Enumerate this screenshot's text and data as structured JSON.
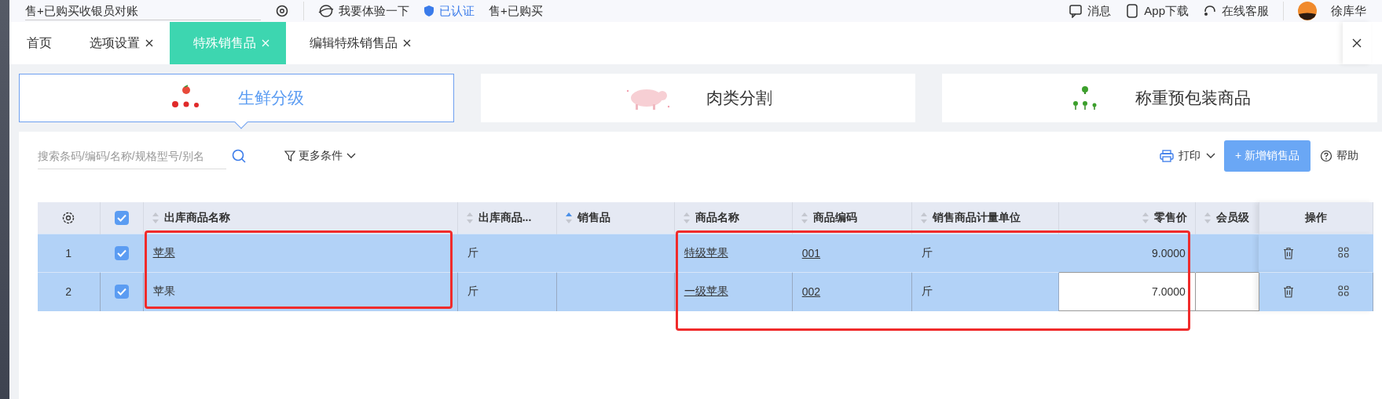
{
  "top_bar": {
    "shop_field": "售+已购买收银员对账",
    "links": [
      {
        "kind": "demo",
        "label": "我要体验一下"
      },
      {
        "kind": "verified",
        "label": "已认证"
      },
      {
        "kind": "plain",
        "label": "售+已购买"
      }
    ],
    "actions": [
      {
        "kind": "message",
        "label": "消息"
      },
      {
        "kind": "app",
        "label": "App下载"
      },
      {
        "kind": "service",
        "label": "在线客服"
      }
    ],
    "user": "徐库华"
  },
  "tabs": [
    {
      "label": "首页",
      "closable": false,
      "selected": false
    },
    {
      "label": "选项设置",
      "closable": true,
      "selected": false
    },
    {
      "label": "特殊销售品",
      "closable": true,
      "selected": true
    },
    {
      "label": "编辑特殊销售品",
      "closable": true,
      "selected": false
    }
  ],
  "categories": [
    {
      "kind": "fruit",
      "label": "生鲜分级",
      "selected": true
    },
    {
      "kind": "pig",
      "label": "肉类分割",
      "selected": false
    },
    {
      "kind": "plant",
      "label": "称重预包装商品",
      "selected": false
    }
  ],
  "toolbar": {
    "search": {
      "placeholder": "搜索条码/编码/名称/规格型号/别名"
    },
    "filter": "更多条件",
    "print": "打印",
    "add_button": "+ 新增销售品",
    "help": "帮助"
  },
  "table": {
    "columns": [
      {
        "kind": "settings"
      },
      {
        "kind": "check",
        "checked": true
      },
      {
        "kind": "text",
        "label": "出库商品名称",
        "sorted": false,
        "boxed": true
      },
      {
        "kind": "text",
        "label": "出库商品...",
        "sorted": false
      },
      {
        "kind": "text",
        "label": "销售品",
        "sorted": true
      },
      {
        "kind": "text",
        "label": "商品名称",
        "sorted": false,
        "boxed": true
      },
      {
        "kind": "text",
        "label": "商品编码",
        "sorted": false,
        "boxed": true
      },
      {
        "kind": "text",
        "label": "销售商品计量单位",
        "sorted": false,
        "boxed": true
      },
      {
        "kind": "number",
        "label": "零售价",
        "sorted": false,
        "boxed": true
      },
      {
        "kind": "text",
        "label": "会员级",
        "sorted": false
      },
      {
        "kind": "actions",
        "label": "操作"
      }
    ],
    "rows": [
      {
        "cells": [
          {
            "text": "1"
          },
          {
            "checked": true
          },
          {
            "text": "苹果",
            "link": true
          },
          {
            "text": "斤"
          },
          {
            "text": ""
          },
          {
            "text": "特级苹果",
            "link": true
          },
          {
            "text": "001",
            "link": true
          },
          {
            "text": "斤"
          },
          {
            "text": "9.0000",
            "editing": false
          },
          {
            "text": ""
          },
          {
            "text": ""
          }
        ]
      },
      {
        "cells": [
          {
            "text": "2"
          },
          {
            "checked": true
          },
          {
            "text": "苹果",
            "link": false
          },
          {
            "text": "斤"
          },
          {
            "text": ""
          },
          {
            "text": "一级苹果",
            "link": true
          },
          {
            "text": "002",
            "link": true
          },
          {
            "text": "斤"
          },
          {
            "text": "7.0000",
            "editing": true
          },
          {
            "text": "",
            "editing": true
          },
          {
            "text": ""
          }
        ]
      }
    ]
  }
}
